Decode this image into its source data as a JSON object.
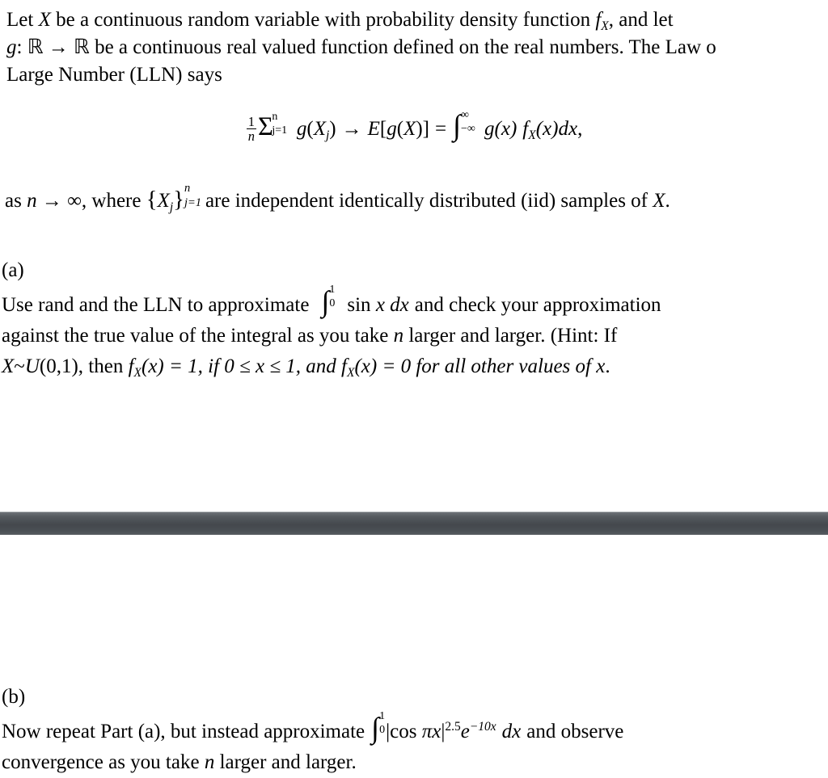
{
  "document": {
    "type": "math-homework-scan",
    "background_color": "#ffffff",
    "text_color": "#000000"
  },
  "intro": {
    "line1_pre": "Let ",
    "line1_var": "X",
    "line1_mid": " be a continuous random variable with probability density function ",
    "line1_f": "f",
    "line1_f_sub": "X",
    "line1_end": ", and let",
    "line2_g": "g",
    "line2_colon": ": ",
    "line2_R1": "ℝ",
    "line2_arrow": " → ",
    "line2_R2": "ℝ",
    "line2_text": " be a continuous real valued function defined on the real numbers.  The Law o",
    "line3": "Large Number (LLN) says"
  },
  "formula": {
    "frac_num": "1",
    "frac_den": "n",
    "sigma": "Σ",
    "sigma_upper": "n",
    "sigma_lower": "j=1",
    "g1": "g",
    "open1": "(",
    "X1": "X",
    "X1_sub": "j",
    "close1": ")",
    "arrow": "→",
    "E": "E",
    "bracket_open": "[",
    "g2": "g",
    "paren_open2": "(",
    "X2": "X",
    "paren_close2": ")",
    "bracket_close": "]",
    "equals": "=",
    "integral": "∫",
    "int_upper": "∞",
    "int_lower": "−∞",
    "g3": "g",
    "x1": "(x)",
    "f": "f",
    "f_sub": "X",
    "x2": "(x)",
    "dx": "dx",
    "comma": ","
  },
  "after_formula": {
    "pre": "as ",
    "n": "n",
    "arrow": " → ",
    "infinity": "∞",
    "mid": ", where ",
    "brace_open": "{",
    "setX": "X",
    "setX_sub": "j",
    "brace_close": "}",
    "corner_up": "n",
    "corner_dn": "j=1",
    "tail_pre": "are independent identically distributed (iid) samples of ",
    "tail_var": "X",
    "tail_end": "."
  },
  "item_a": {
    "marker": "(a)",
    "line1_pre": "Use rand and the LLN to approximate",
    "integral": "∫",
    "int_upper": "1",
    "int_lower": "0",
    "integrand": "sin x dx",
    "line1_post": "and check your approximation",
    "line2": "against the true value of the integral as you take n larger and larger. (Hint: If",
    "line2_a": "against the true value of the ",
    "line2_integral": "integral",
    "line2_b": " as you take ",
    "line2_n": "n",
    "line2_c": " larger and larger. (Hint: If",
    "line3_X": "X",
    "line3_tilde": "~",
    "line3_U": "U",
    "line3_args": "(0,1)",
    "line3_then": ", then ",
    "line3_f1": "f",
    "line3_f1_sub": "X",
    "line3_eq1": "(x) = 1, if 0 ≤ x ≤ 1, and ",
    "line3_f2": "f",
    "line3_f2_sub": "X",
    "line3_eq2": "(x) = 0 for all other values of ",
    "line3_x": "x",
    "line3_end": "."
  },
  "item_b": {
    "marker": "(b)",
    "line1_pre": "Now repeat Part (a), but instead approximate",
    "integral": "∫",
    "int_upper": "1",
    "int_lower": "0",
    "abs_open": "|cos ",
    "pi": "π",
    "pi_x": "x",
    "abs_close": "|",
    "exponent": "2.5",
    "e": "e",
    "e_exp": "−10x",
    "dx": "dx",
    "line1_post": "and observe",
    "line2": "convergence as you take n larger and larger.",
    "line2_a": "convergence as you take ",
    "line2_n": "n",
    "line2_b": " larger and larger."
  },
  "divider": {
    "name": "dark-horizontal-bar",
    "color_top": "#6f7479",
    "color_mid": "#44484d",
    "color_bottom": "#585d62"
  }
}
